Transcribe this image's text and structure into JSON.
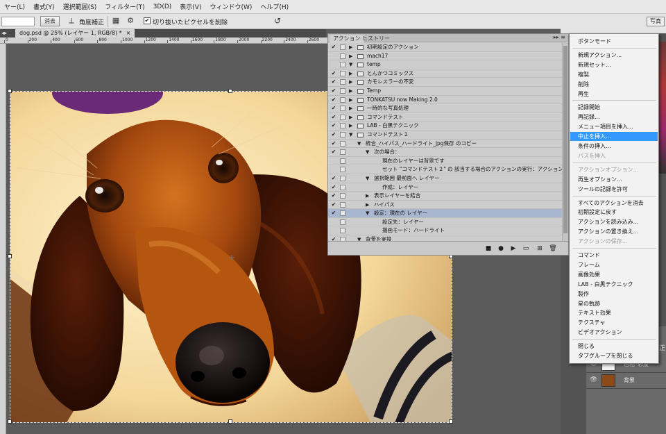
{
  "menubar": [
    "ヤー(L)",
    "書式(Y)",
    "選択範囲(S)",
    "フィルター(T)",
    "3D(D)",
    "表示(V)",
    "ウィンドウ(W)",
    "ヘルプ(H)"
  ],
  "options": {
    "erase_label": "消去",
    "straighten_label": "角度補正",
    "delete_cropped_label": "切り抜いたピクセルを削除",
    "delete_cropped_checked": true,
    "right_button": "写真"
  },
  "document_tab": {
    "title": "dog.psd @ 25% (レイヤー 1, RGB/8) *",
    "close": "×"
  },
  "ruler_ticks": [
    "0",
    "200",
    "400",
    "600",
    "800",
    "1000",
    "1200",
    "1400",
    "1600",
    "1800",
    "2000",
    "2200",
    "2400",
    "2600"
  ],
  "actions_panel": {
    "tabs": [
      "アクション",
      "ヒストリー"
    ],
    "rows": [
      {
        "check": "✔",
        "twisty": "▶",
        "folder": true,
        "text": "初期設定のアクション",
        "level": 0
      },
      {
        "check": "",
        "twisty": "▶",
        "folder": true,
        "text": "mach17",
        "level": 0
      },
      {
        "check": "",
        "twisty": "▼",
        "folder": true,
        "text": "temp",
        "level": 0
      },
      {
        "check": "✔",
        "twisty": "▶",
        "folder": true,
        "text": "とんかつコミックス",
        "level": 0
      },
      {
        "check": "✔",
        "twisty": "▶",
        "folder": true,
        "text": "カモレスラーの不安",
        "level": 0
      },
      {
        "check": "✔",
        "twisty": "▶",
        "folder": true,
        "text": "Temp",
        "level": 0
      },
      {
        "check": "✔",
        "twisty": "▶",
        "folder": true,
        "text": "TONKATSU now Making 2.0",
        "level": 0
      },
      {
        "check": "✔",
        "twisty": "▶",
        "folder": true,
        "text": "一時的な写真処理",
        "level": 0
      },
      {
        "check": "✔",
        "twisty": "▶",
        "folder": true,
        "text": "コマンドテスト",
        "level": 0
      },
      {
        "check": "✔",
        "twisty": "▶",
        "folder": true,
        "text": "LAB - 白黒テクニック",
        "level": 0
      },
      {
        "check": "✔",
        "twisty": "▼",
        "folder": true,
        "text": "コマンドテスト２",
        "level": 0
      },
      {
        "check": "✔",
        "twisty": "▼",
        "folder": false,
        "text": "統合_ハイパス_ハードライト_jpg保存 のコピー",
        "level": 1
      },
      {
        "check": "✔",
        "twisty": "▼",
        "folder": false,
        "text": "次の場合：",
        "level": 2
      },
      {
        "check": "",
        "twisty": "",
        "folder": false,
        "text": "現在のレイヤーは背景です",
        "level": 3
      },
      {
        "check": "",
        "twisty": "",
        "folder": false,
        "text": "セット \"コマンドテスト２\" の 該当する場合のアクションの実行：アクション \"背景を実換\"",
        "level": 3
      },
      {
        "check": "✔",
        "twisty": "▼",
        "folder": false,
        "text": "選択範囲 最前面へ レイヤー",
        "level": 2
      },
      {
        "check": "✔",
        "twisty": "",
        "folder": false,
        "text": "作成：レイヤー",
        "level": 3
      },
      {
        "check": "✔",
        "twisty": "▶",
        "folder": false,
        "text": "表示レイヤーを結合",
        "level": 2
      },
      {
        "check": "✔",
        "twisty": "▶",
        "folder": false,
        "text": "ハイパス",
        "level": 2
      },
      {
        "check": "✔",
        "twisty": "▼",
        "folder": false,
        "text": "設定：現在の レイヤー",
        "level": 2,
        "selected": true
      },
      {
        "check": "",
        "twisty": "",
        "folder": false,
        "text": "設定先：レイヤー",
        "level": 3
      },
      {
        "check": "",
        "twisty": "",
        "folder": false,
        "text": "描画モード：ハードライト",
        "level": 3
      },
      {
        "check": "✔",
        "twisty": "▼",
        "folder": false,
        "text": "背景を実換",
        "level": 1
      },
      {
        "check": "✔",
        "twisty": "▶",
        "folder": false,
        "text": "設定：背景",
        "level": 2
      }
    ]
  },
  "context_menu": {
    "items": [
      {
        "label": "ボタンモード",
        "state": "normal"
      },
      {
        "sep": true
      },
      {
        "label": "新規アクション...",
        "state": "normal"
      },
      {
        "label": "新規セット...",
        "state": "normal"
      },
      {
        "label": "複製",
        "state": "normal"
      },
      {
        "label": "削除",
        "state": "normal"
      },
      {
        "label": "再生",
        "state": "normal"
      },
      {
        "sep": true
      },
      {
        "label": "記録開始",
        "state": "normal"
      },
      {
        "label": "再記録...",
        "state": "normal"
      },
      {
        "label": "メニュー項目を挿入...",
        "state": "normal"
      },
      {
        "label": "中止を挿入...",
        "state": "highlighted"
      },
      {
        "label": "条件の挿入...",
        "state": "normal"
      },
      {
        "label": "パスを挿入",
        "state": "disabled"
      },
      {
        "sep": true
      },
      {
        "label": "アクションオプション...",
        "state": "disabled"
      },
      {
        "label": "再生オプション...",
        "state": "normal"
      },
      {
        "label": "ツールの記録を許可",
        "state": "normal"
      },
      {
        "sep": true
      },
      {
        "label": "すべてのアクションを消去",
        "state": "normal"
      },
      {
        "label": "初期設定に戻す",
        "state": "normal"
      },
      {
        "label": "アクションを読み込み...",
        "state": "normal"
      },
      {
        "label": "アクションの置き換え...",
        "state": "normal"
      },
      {
        "label": "アクションの保存...",
        "state": "disabled"
      },
      {
        "sep": true
      },
      {
        "label": "コマンド",
        "state": "normal"
      },
      {
        "label": "フレーム",
        "state": "normal"
      },
      {
        "label": "画像効果",
        "state": "normal"
      },
      {
        "label": "LAB - 白黒テクニック",
        "state": "normal"
      },
      {
        "label": "製作",
        "state": "normal"
      },
      {
        "label": "星の軌跡",
        "state": "normal"
      },
      {
        "label": "テキスト効果",
        "state": "normal"
      },
      {
        "label": "テクスチャ",
        "state": "normal"
      },
      {
        "label": "ビデオアクション",
        "state": "normal"
      },
      {
        "sep": true
      },
      {
        "label": "閉じる",
        "state": "normal"
      },
      {
        "label": "タブグループを閉じる",
        "state": "normal"
      }
    ]
  },
  "layers": [
    {
      "name": "色相･彩度",
      "thumb_color": "#f4f4f4"
    },
    {
      "name": "背景",
      "thumb_color": "#8a4a1a"
    }
  ],
  "layers_partial_label": "正"
}
